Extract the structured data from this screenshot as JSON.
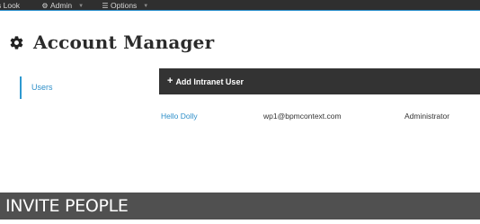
{
  "topbar": {
    "items": [
      {
        "label": "s Look",
        "icon": "",
        "caret": false
      },
      {
        "label": "Admin",
        "icon": "gear-icon",
        "caret": true
      },
      {
        "label": "Options",
        "icon": "list-icon",
        "caret": true
      }
    ]
  },
  "page": {
    "title": "Account Manager",
    "title_icon": "gear-icon"
  },
  "sidebar": {
    "items": [
      {
        "label": "Users",
        "active": true
      }
    ]
  },
  "toolbar": {
    "add_label": "Add Intranet User",
    "add_icon": "plus-icon"
  },
  "users": {
    "rows": [
      {
        "name": "Hello Dolly",
        "email": "wp1@bpmcontext.com",
        "role": "Administrator"
      }
    ]
  },
  "banner": {
    "text": "INVITE PEOPLE"
  },
  "colors": {
    "topbar_bg": "#2f2f2f",
    "accent_blue": "#2e8fc9",
    "toolbar_bg": "#333333",
    "banner_bg": "#505050"
  }
}
